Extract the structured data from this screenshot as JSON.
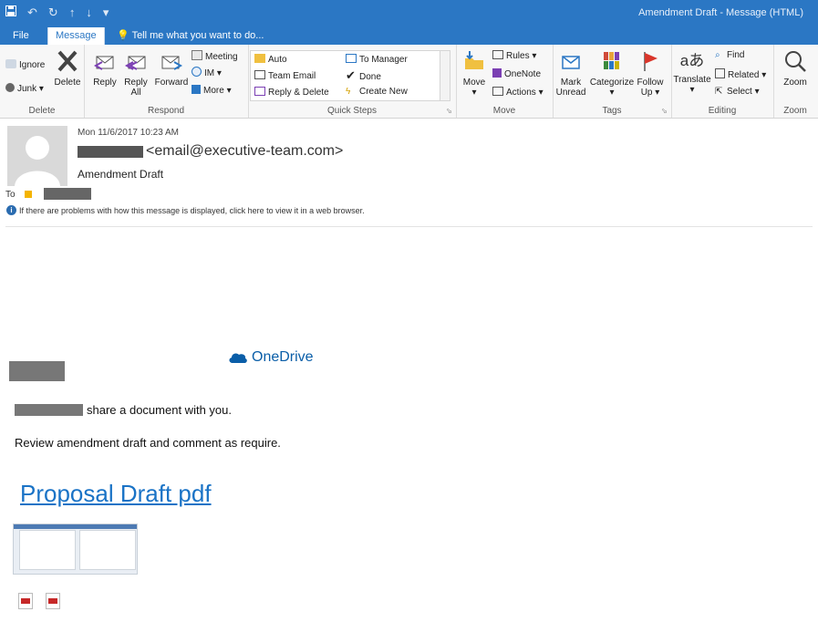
{
  "window": {
    "title": "Amendment Draft - Message (HTML)"
  },
  "tabs": [
    {
      "label": "File"
    },
    {
      "label": "Message"
    },
    {
      "label": "Tell me what you want to do..."
    }
  ],
  "ribbon": {
    "groups": [
      {
        "label": "Delete"
      },
      {
        "label": "Respond"
      },
      {
        "label": "Quick Steps"
      },
      {
        "label": "Move"
      },
      {
        "label": "Tags"
      },
      {
        "label": "Editing"
      },
      {
        "label": "Zoom"
      }
    ],
    "delete": {
      "ignore": "Ignore",
      "junk": "Junk",
      "delete": "Delete"
    },
    "respond": {
      "reply": "Reply",
      "reply_all_1": "Reply",
      "reply_all_2": "All",
      "forward": "Forward",
      "meeting": "Meeting",
      "im": "IM",
      "more": "More"
    },
    "quick_steps": {
      "auto": "Auto",
      "team_email": "Team Email",
      "reply_delete": "Reply & Delete",
      "to_manager": "To Manager",
      "done": "Done",
      "create_new": "Create New"
    },
    "move": {
      "move": "Move",
      "rules": "Rules",
      "onenote": "OneNote",
      "actions": "Actions"
    },
    "tags": {
      "mark_unread_1": "Mark",
      "mark_unread_2": "Unread",
      "categorize": "Categorize",
      "follow_up_1": "Follow",
      "follow_up_2": "Up"
    },
    "editing": {
      "translate": "Translate",
      "find": "Find",
      "related": "Related",
      "select": "Select"
    },
    "zoom": {
      "zoom": "Zoom"
    }
  },
  "message": {
    "date": "Mon 11/6/2017 10:23 AM",
    "sender_email": "<email@executive-team.com>",
    "subject": "Amendment Draft",
    "to_label": "To",
    "info_text": "If there are problems with how this message is displayed, click here to view it in a web browser."
  },
  "body": {
    "onedrive": "OneDrive",
    "share_text": "share a document with you.",
    "review_text": "Review amendment draft and comment as require.",
    "link_text": "Proposal Draft pdf"
  }
}
